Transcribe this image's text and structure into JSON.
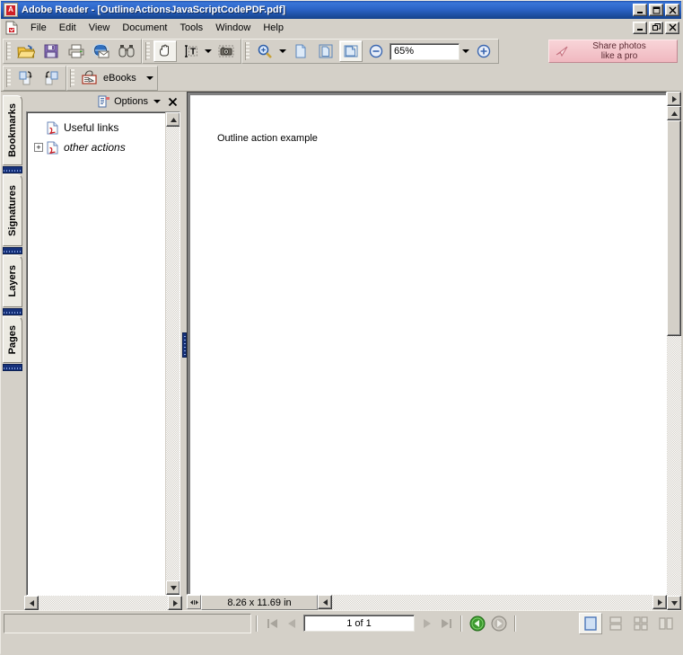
{
  "window": {
    "title": "Adobe Reader - [OutlineActionsJavaScriptCodePDF.pdf]",
    "app_icon": "adobe-reader-icon",
    "controls": {
      "minimize": "_",
      "maximize": "□",
      "restore": "❐",
      "close": "✕"
    }
  },
  "menubar": {
    "doc_icon": "pdf-document-icon",
    "items": [
      {
        "label": "File"
      },
      {
        "label": "Edit"
      },
      {
        "label": "View"
      },
      {
        "label": "Document"
      },
      {
        "label": "Tools"
      },
      {
        "label": "Window"
      },
      {
        "label": "Help"
      }
    ]
  },
  "toolbar": {
    "file_group": [
      {
        "name": "open-file-button",
        "icon": "open-folder-icon"
      },
      {
        "name": "save-file-button",
        "icon": "floppy-save-icon"
      },
      {
        "name": "print-button",
        "icon": "printer-icon"
      },
      {
        "name": "email-button",
        "icon": "email-globe-icon"
      },
      {
        "name": "search-button",
        "icon": "binoculars-icon"
      }
    ],
    "tools_group": [
      {
        "name": "hand-tool-button",
        "icon": "hand-icon",
        "selected": true
      },
      {
        "name": "select-text-tool-button",
        "icon": "text-select-icon",
        "selected": false
      },
      {
        "name": "snapshot-tool-button",
        "icon": "camera-icon",
        "selected": false
      }
    ],
    "zoom_group": {
      "zoom_tool": {
        "name": "zoom-in-tool-button",
        "icon": "magnifier-icon"
      },
      "page_view_buttons": [
        {
          "name": "actual-size-button",
          "icon": "page-actual-size-icon",
          "selected": false
        },
        {
          "name": "fit-page-button",
          "icon": "page-fit-icon",
          "selected": false
        },
        {
          "name": "fit-width-button",
          "icon": "page-fit-width-icon",
          "selected": true
        }
      ],
      "zoom_out_label": "zoom-out-icon",
      "zoom_value": "65%",
      "zoom_in_label": "zoom-in-icon"
    },
    "share_banner": {
      "line1": "Share photos",
      "line2": "like a pro",
      "icon": "paper-plane-icon",
      "color": "#f2bcc4"
    },
    "row2": {
      "rotate_buttons": [
        {
          "name": "rotate-clockwise-button",
          "icon": "rotate-clockwise-icon"
        },
        {
          "name": "rotate-counterclockwise-button",
          "icon": "rotate-counterclockwise-icon"
        }
      ],
      "ebooks": {
        "label": "eBooks",
        "icon": "ebooks-icon"
      }
    }
  },
  "sidebar": {
    "tabs": [
      {
        "label": "Bookmarks",
        "selected": true
      },
      {
        "label": "Signatures",
        "selected": false
      },
      {
        "label": "Layers",
        "selected": false
      },
      {
        "label": "Pages",
        "selected": false
      }
    ],
    "header": {
      "panel_icon": "bookmarks-panel-icon",
      "options_label": "Options",
      "close_label": "✕"
    },
    "bookmarks": [
      {
        "label": "Useful links",
        "italic": false,
        "expandable": false,
        "icon": "pdf-bookmark-icon"
      },
      {
        "label": "other actions",
        "italic": true,
        "expandable": true,
        "expand_glyph": "+",
        "icon": "pdf-bookmark-icon"
      }
    ]
  },
  "document": {
    "page_text": "Outline action example",
    "page_size": "8.26 x 11.69 in"
  },
  "statusbar": {
    "nav": {
      "first_label": "first-page-icon",
      "prev_label": "previous-page-icon",
      "page_value": "1 of 1",
      "next_label": "next-page-icon",
      "last_label": "last-page-icon",
      "back_label": "previous-view-icon",
      "forward_label": "next-view-icon",
      "back_color": "#3c9a2e",
      "forward_color": "#b8b4ac"
    },
    "view_modes": [
      {
        "name": "single-page-view-button",
        "icon": "single-page-icon",
        "selected": true
      },
      {
        "name": "continuous-view-button",
        "icon": "continuous-page-icon",
        "selected": false
      },
      {
        "name": "facing-continuous-view-button",
        "icon": "facing-continuous-icon",
        "selected": false
      },
      {
        "name": "facing-view-button",
        "icon": "facing-page-icon",
        "selected": false
      }
    ]
  }
}
